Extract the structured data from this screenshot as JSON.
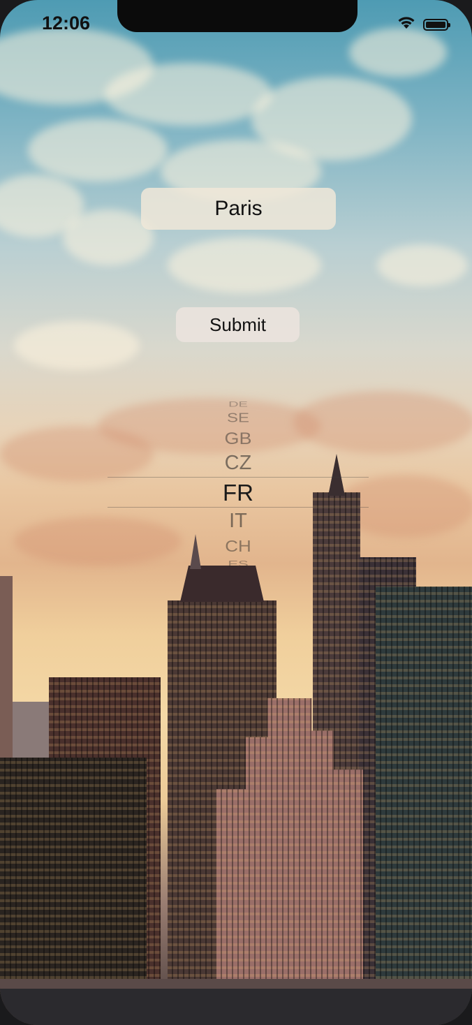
{
  "status_bar": {
    "time": "12:06",
    "wifi_icon": "wifi-icon",
    "battery_icon": "battery-icon"
  },
  "form": {
    "city_value": "Paris",
    "submit_label": "Submit"
  },
  "country_picker": {
    "items_above": [
      "DE",
      "SE",
      "GB",
      "CZ"
    ],
    "selected": "FR",
    "items_below": [
      "IT",
      "CH",
      "ES"
    ]
  },
  "colors": {
    "sky_top": "#4e9bb3",
    "sunset": "#e9c6a0",
    "field_background": "#f0e8d8",
    "button_background": "#ece4de"
  }
}
